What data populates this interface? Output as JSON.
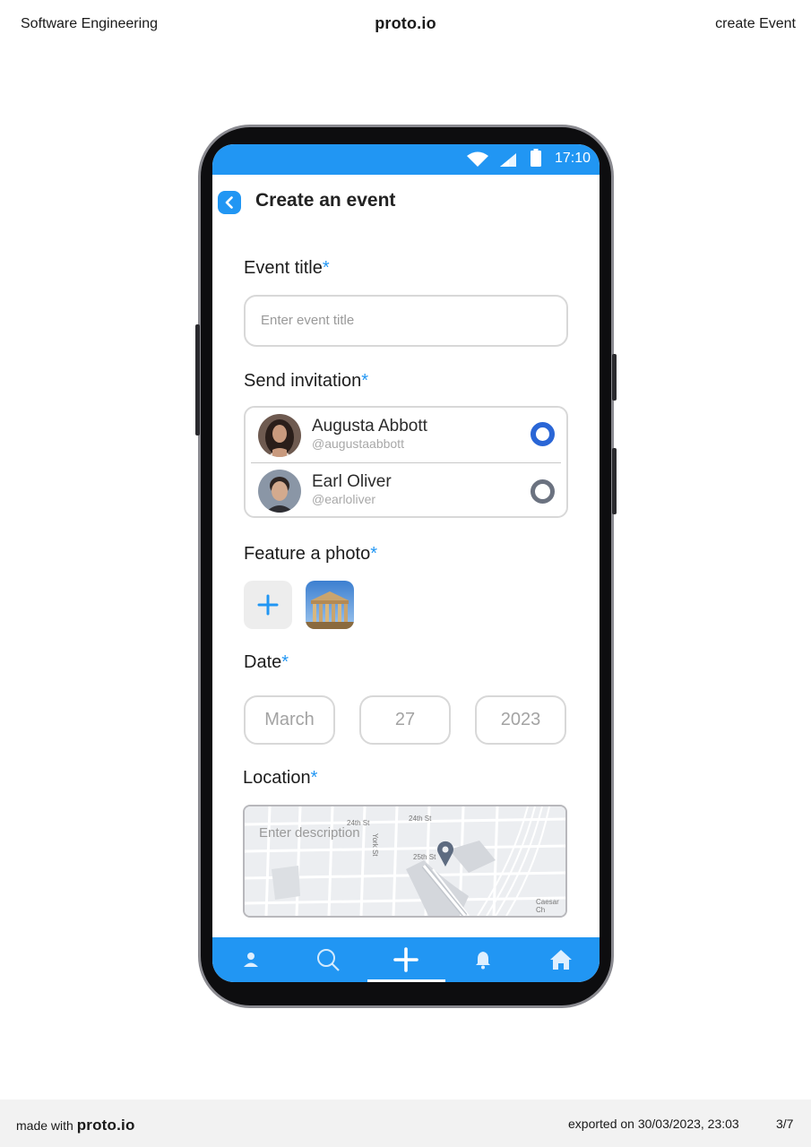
{
  "page": {
    "header_left": "Software Engineering",
    "brand": "proto.io",
    "header_right": "create Event"
  },
  "status_bar": {
    "time": "17:10",
    "icons": [
      "wifi-icon",
      "signal-icon",
      "battery-icon"
    ]
  },
  "nav": {
    "title": "Create an event",
    "back_icon": "chevron-left-icon"
  },
  "form": {
    "event_title": {
      "label": "Event title",
      "required_mark": "*",
      "placeholder": "Enter event title"
    },
    "invitation": {
      "label": "Send invitation",
      "required_mark": "*",
      "invitees": [
        {
          "name": "Augusta Abbott",
          "handle": "@augustaabbott",
          "selected": true
        },
        {
          "name": "Earl Oliver",
          "handle": "@earloliver",
          "selected": false
        }
      ]
    },
    "photo": {
      "label": "Feature a photo",
      "required_mark": "*",
      "add_icon": "plus-icon",
      "thumbnail": "temple-photo"
    },
    "date": {
      "label": "Date",
      "required_mark": "*",
      "month": "March",
      "day": "27",
      "year": "2023"
    },
    "location": {
      "label": "Location",
      "required_mark": "*",
      "placeholder": "Enter description",
      "street_labels": [
        "24th St",
        "24th St",
        "25th St",
        "York St",
        "Caesar Ch"
      ],
      "pin_icon": "map-pin-icon"
    }
  },
  "bottom_nav": {
    "items": [
      {
        "icon": "person-icon",
        "active": false
      },
      {
        "icon": "search-icon",
        "active": false
      },
      {
        "icon": "plus-icon",
        "active": true
      },
      {
        "icon": "bell-icon",
        "active": false
      },
      {
        "icon": "home-icon",
        "active": false
      }
    ]
  },
  "colors": {
    "accent": "#2196f3",
    "radio_on": "#2a66d6",
    "radio_off": "#6b7280"
  },
  "footer": {
    "made_with": "made with",
    "brand": "proto.io",
    "exported": "exported on 30/03/2023, 23:03",
    "page": "3/7"
  }
}
